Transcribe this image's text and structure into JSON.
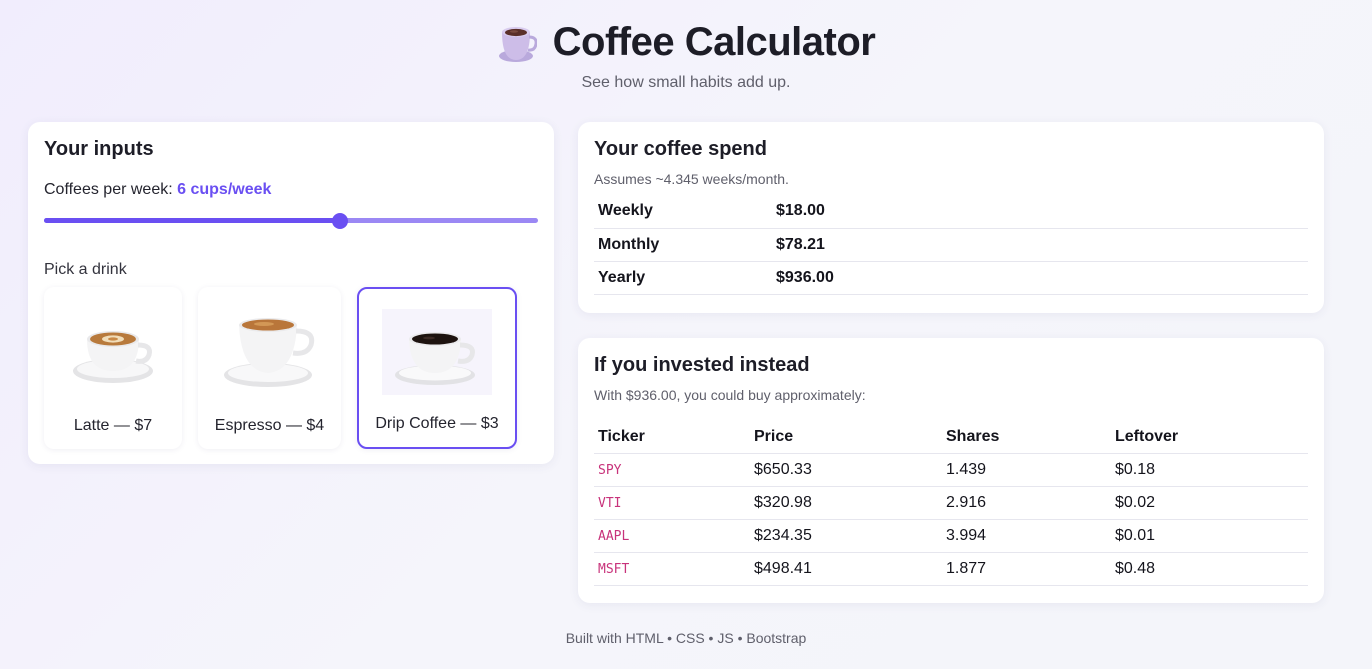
{
  "header": {
    "icon": "coffee-mug-icon",
    "title": "Coffee Calculator",
    "subtitle": "See how small habits add up."
  },
  "inputs": {
    "heading": "Your inputs",
    "cups_label": "Coffees per week:",
    "cups_value": "6 cups/week",
    "slider_fraction": 0.6,
    "pick_label": "Pick a drink",
    "drinks": [
      {
        "label": "Latte — $7",
        "image": "latte-cup-image",
        "selected": false
      },
      {
        "label": "Espresso — $4",
        "image": "espresso-cup-image",
        "selected": false
      },
      {
        "label": "Drip Coffee — $3",
        "image": "drip-coffee-cup-image",
        "selected": true
      }
    ]
  },
  "spend": {
    "heading": "Your coffee spend",
    "note": "Assumes ~4.345 weeks/month.",
    "rows": [
      {
        "label": "Weekly",
        "value": "$18.00"
      },
      {
        "label": "Monthly",
        "value": "$78.21"
      },
      {
        "label": "Yearly",
        "value": "$936.00"
      }
    ]
  },
  "invest": {
    "heading": "If you invested instead",
    "note": "With $936.00, you could buy approximately:",
    "columns": [
      "Ticker",
      "Price",
      "Shares",
      "Leftover"
    ],
    "rows": [
      {
        "ticker": "SPY",
        "price": "$650.33",
        "shares": "1.439",
        "leftover": "$0.18"
      },
      {
        "ticker": "VTI",
        "price": "$320.98",
        "shares": "2.916",
        "leftover": "$0.02"
      },
      {
        "ticker": "AAPL",
        "price": "$234.35",
        "shares": "3.994",
        "leftover": "$0.01"
      },
      {
        "ticker": "MSFT",
        "price": "$498.41",
        "shares": "1.877",
        "leftover": "$0.48"
      }
    ]
  },
  "footer": {
    "text": "Built with HTML • CSS • JS • Bootstrap"
  },
  "colors": {
    "accent": "#6a4ff2",
    "ticker": "#c8337b"
  }
}
